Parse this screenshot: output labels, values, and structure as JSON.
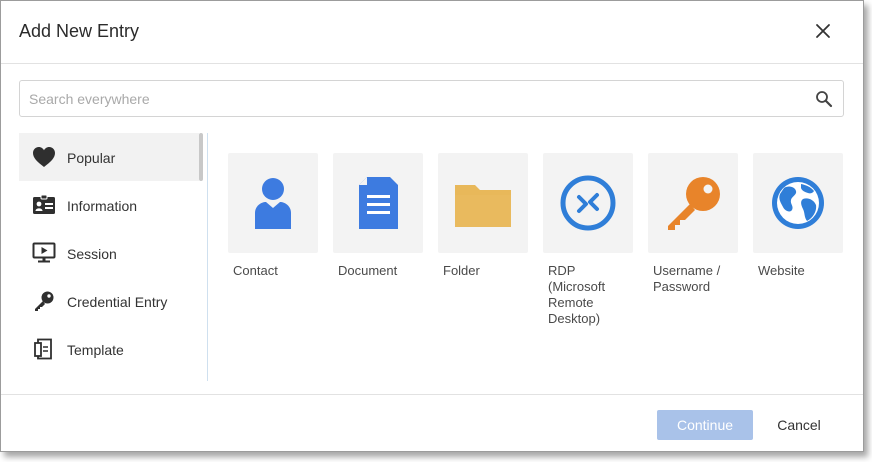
{
  "dialog": {
    "title": "Add New Entry",
    "close_icon": "close-icon"
  },
  "search": {
    "placeholder": "Search everywhere",
    "value": "",
    "icon": "search-icon"
  },
  "sidebar": {
    "items": [
      {
        "label": "Popular",
        "icon": "heart-icon",
        "active": true
      },
      {
        "label": "Information",
        "icon": "id-card-icon",
        "active": false
      },
      {
        "label": "Session",
        "icon": "monitor-play-icon",
        "active": false
      },
      {
        "label": "Credential Entry",
        "icon": "key-icon",
        "active": false
      },
      {
        "label": "Template",
        "icon": "template-icon",
        "active": false
      }
    ]
  },
  "entries": [
    {
      "label": "Contact",
      "icon": "contact-icon",
      "color": "#3d7be0"
    },
    {
      "label": "Document",
      "icon": "document-icon",
      "color": "#3d7be0"
    },
    {
      "label": "Folder",
      "icon": "folder-icon",
      "color": "#e8b85a"
    },
    {
      "label": "RDP\n(Microsoft\nRemote\nDesktop)",
      "icon": "rdp-icon",
      "color": "#2f7ed8"
    },
    {
      "label": "Username /\nPassword",
      "icon": "key-icon",
      "color": "#e8842a"
    },
    {
      "label": "Website",
      "icon": "globe-icon",
      "color": "#2f7ed8"
    }
  ],
  "footer": {
    "continue_label": "Continue",
    "cancel_label": "Cancel"
  },
  "colors": {
    "accent": "#3d7be0",
    "continue_disabled": "#a9c2e9",
    "tile_bg": "#f3f3f3"
  }
}
